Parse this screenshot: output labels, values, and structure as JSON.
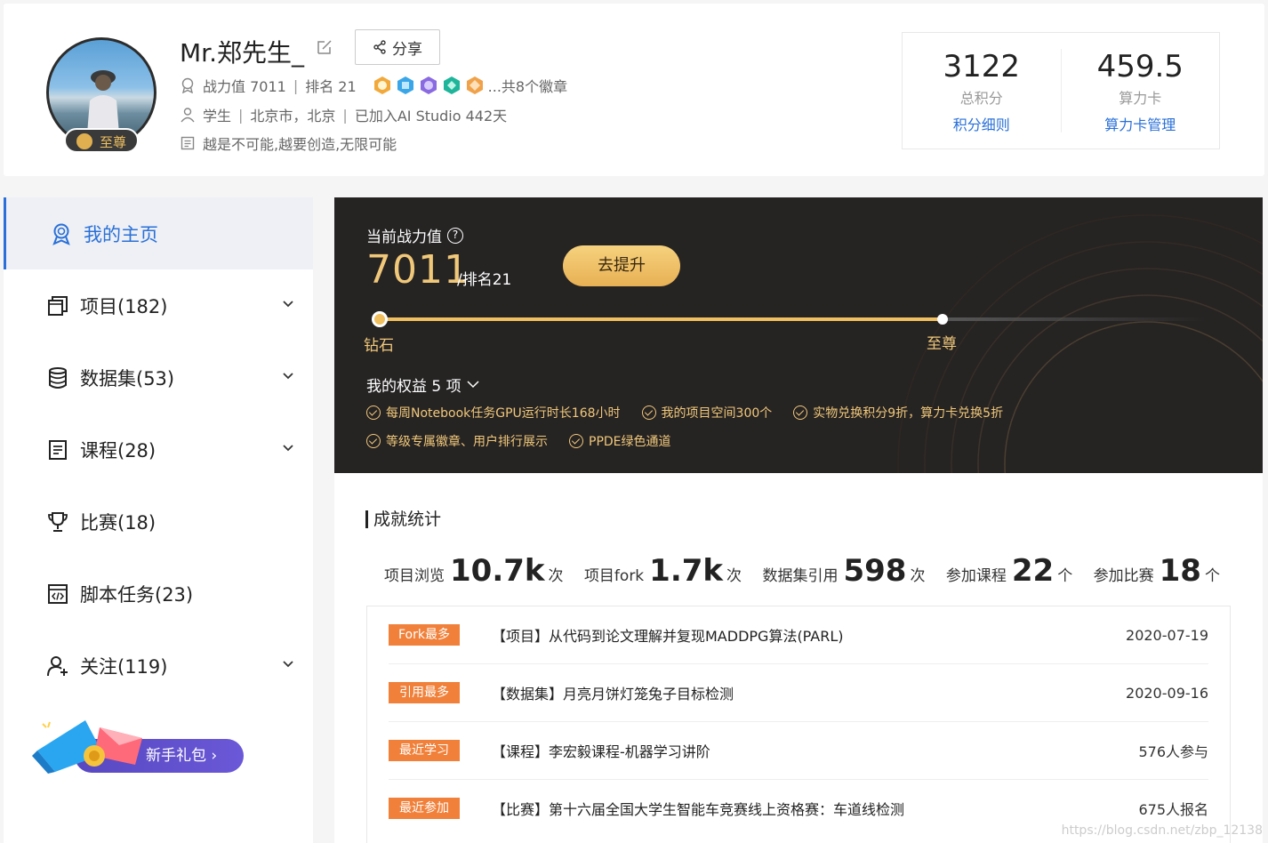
{
  "profile": {
    "name": "Mr.郑先生_",
    "share_label": "分享",
    "badge_label": "至尊",
    "power_label": "战力值 7011",
    "rank_label": "排名 21",
    "medals_label": "...共8个徽章",
    "role": "学生",
    "location": "北京市，北京",
    "joined": "已加入AI Studio 442天",
    "motto": "越是不可能,越要创造,无限可能"
  },
  "stats": [
    {
      "value": "3122",
      "label": "总积分",
      "link": "积分细则"
    },
    {
      "value": "459.5",
      "label": "算力卡",
      "link": "算力卡管理"
    }
  ],
  "sidebar": {
    "items": [
      {
        "label": "我的主页",
        "icon": "badge-icon",
        "active": true
      },
      {
        "label": "项目(182)",
        "icon": "project-icon"
      },
      {
        "label": "数据集(53)",
        "icon": "database-icon"
      },
      {
        "label": "课程(28)",
        "icon": "course-icon"
      },
      {
        "label": "比赛(18)",
        "icon": "trophy-icon"
      },
      {
        "label": "脚本任务(23)",
        "icon": "script-icon"
      },
      {
        "label": "关注(119)",
        "icon": "follow-icon"
      }
    ],
    "gift_label": "新手礼包 ›"
  },
  "power": {
    "title": "当前战力值",
    "value": "7011",
    "rank": "/排名21",
    "button": "去提升",
    "progress": 0.72,
    "level_current": "钻石",
    "level_next": "至尊",
    "benefits_title": "我的权益 5 项",
    "benefits": [
      "每周Notebook任务GPU运行时长168小时",
      "我的项目空间300个",
      "实物兑换积分9折，算力卡兑换5折",
      "等级专属徽章、用户排行展示",
      "PPDE绿色通道"
    ]
  },
  "achievements": {
    "title": "成就统计",
    "metrics": [
      {
        "label": "项目浏览",
        "value": "10.7k",
        "unit": "次"
      },
      {
        "label": "项目fork",
        "value": "1.7k",
        "unit": "次"
      },
      {
        "label": "数据集引用",
        "value": "598",
        "unit": "次"
      },
      {
        "label": "参加课程",
        "value": "22",
        "unit": "个"
      },
      {
        "label": "参加比赛",
        "value": "18",
        "unit": "个"
      }
    ],
    "rows": [
      {
        "tag": "Fork最多",
        "text": "【项目】从代码到论文理解并复现MADDPG算法(PARL)",
        "meta": "2020-07-19"
      },
      {
        "tag": "引用最多",
        "text": "【数据集】月亮月饼灯笼兔子目标检测",
        "meta": "2020-09-16"
      },
      {
        "tag": "最近学习",
        "text": "【课程】李宏毅课程-机器学习讲阶",
        "meta": "576人参与"
      },
      {
        "tag": "最近参加",
        "text": "【比赛】第十六届全国大学生智能车竞赛线上资格赛：车道线检测",
        "meta": "675人报名"
      }
    ]
  },
  "watermark": "https://blog.csdn.net/zbp_12138"
}
